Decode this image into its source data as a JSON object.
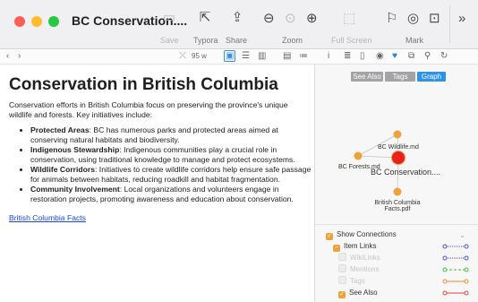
{
  "window": {
    "title": "BC Conservation...."
  },
  "toolbar": {
    "save": "Save",
    "typora": "Typora",
    "share": "Share",
    "zoom": "Zoom",
    "full_screen": "Full Screen",
    "mark": "Mark"
  },
  "subbar": {
    "zoom_value": "95 w"
  },
  "document": {
    "heading": "Conservation in British Columbia",
    "intro": "Conservation efforts in British Columbia focus on preserving the province's unique wildlife and forests. Key initiatives include:",
    "bullets": [
      {
        "term": "Protected Areas",
        "text": ": BC has numerous parks and protected areas aimed at conserving natural habitats and biodiversity."
      },
      {
        "term": "Indigenous Stewardship",
        "text": ": Indigenous communities play a crucial role in conservation, using traditional knowledge to manage and protect ecosystems."
      },
      {
        "term": "Wildlife Corridors",
        "text": ": Initiatives to create wildlife corridors help ensure safe passage for animals between habitats, reducing roadkill and habitat fragmentation."
      },
      {
        "term": "Community Involvement",
        "text": ": Local organizations and volunteers engage in restoration projects, promoting awareness and education about conservation."
      }
    ],
    "link": "British Columbia Facts"
  },
  "panel": {
    "tabs": [
      "See Also",
      "Tags",
      "Graph"
    ],
    "active_tab": "Graph",
    "graph": {
      "nodes": [
        "BC Wildlife.md",
        "BC Forests.md",
        "BC Conservation....",
        "British Columbia Facts.pdf"
      ]
    },
    "show_connections": "Show Connections",
    "items": [
      {
        "label": "Item Links",
        "state": "partial",
        "line_color": "#4a4ad8",
        "enabled": true
      },
      {
        "label": "WikiLinks",
        "state": "off",
        "line_color": "#4a4ad8",
        "enabled": false
      },
      {
        "label": "Mentions",
        "state": "off",
        "line_color": "#3cbf3c",
        "enabled": false
      },
      {
        "label": "Tags",
        "state": "off",
        "line_color": "#f08a2a",
        "enabled": false
      },
      {
        "label": "See Also",
        "state": "on",
        "line_color": "#e04040",
        "enabled": true
      }
    ]
  },
  "colors": {
    "accent": "#2f93e5",
    "checkbox": "#f0a13a",
    "node": "#f0a13a",
    "current_node": "#e8201e"
  }
}
